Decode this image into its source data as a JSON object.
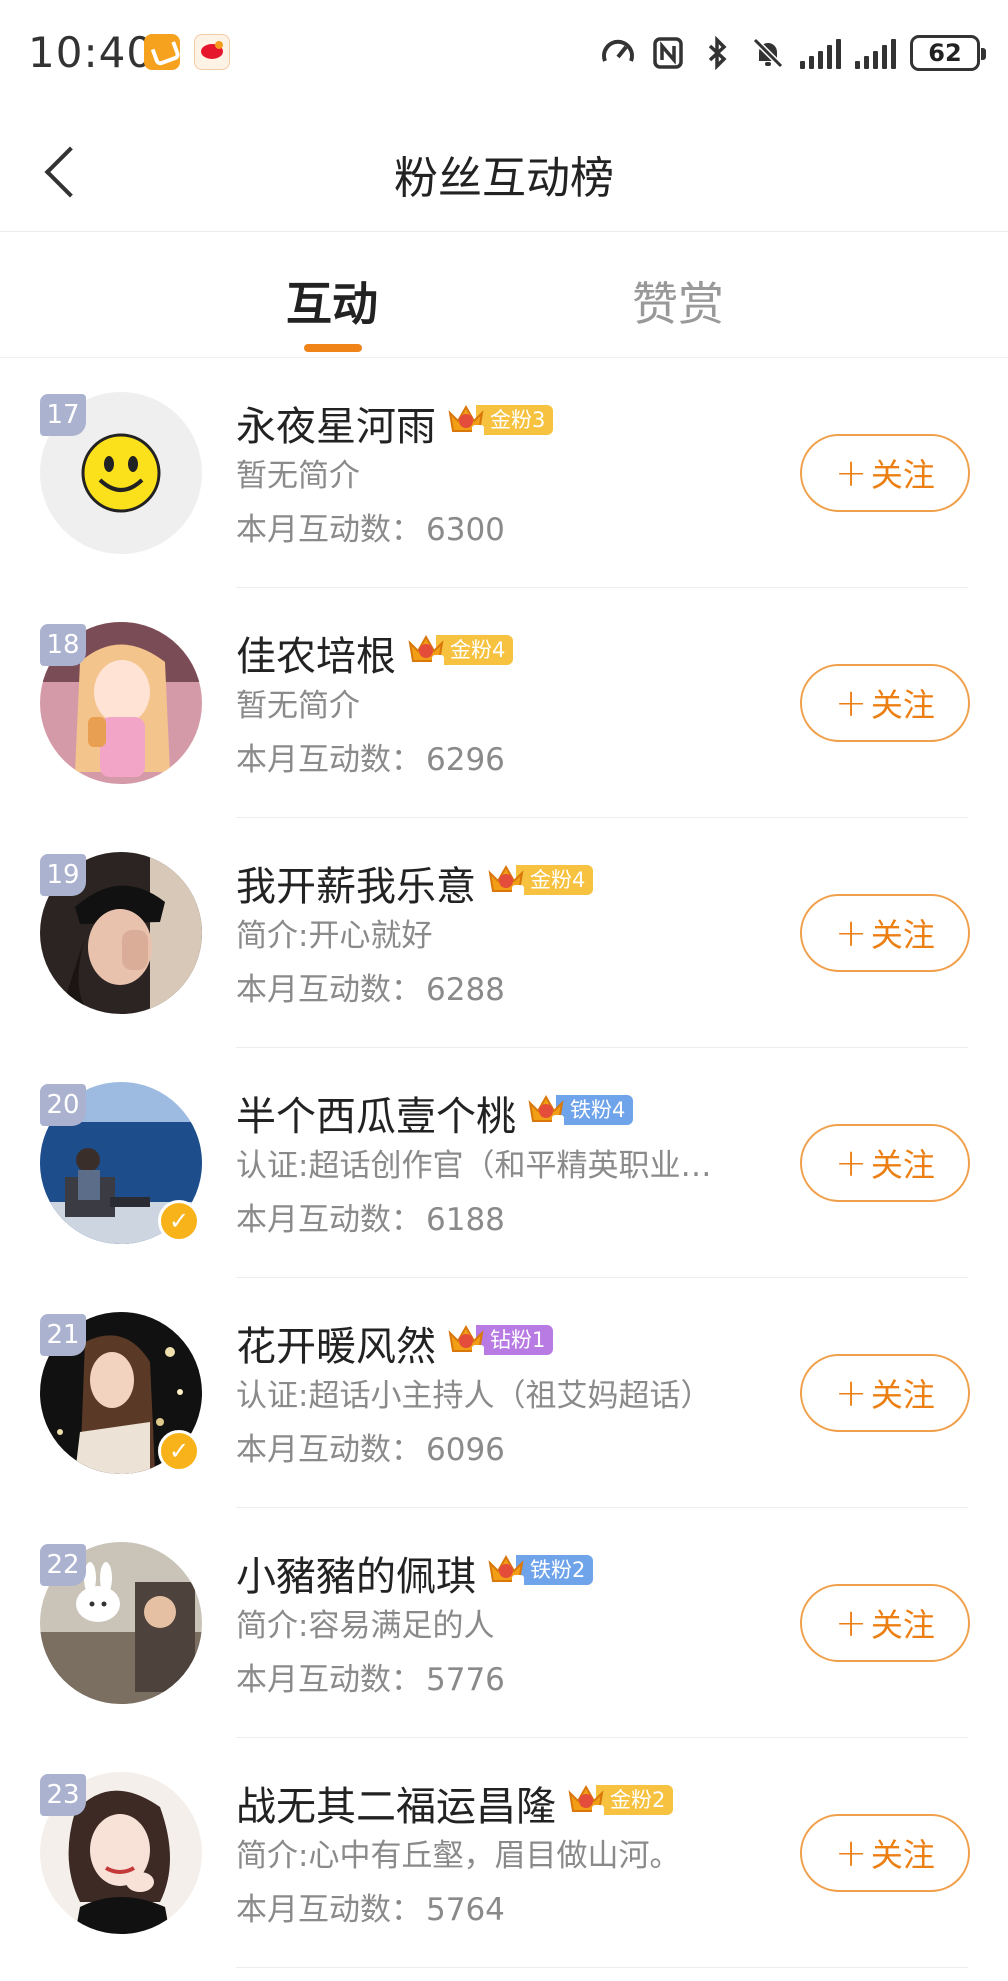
{
  "status_bar": {
    "time": "10:40",
    "battery": "62"
  },
  "header": {
    "title": "粉丝互动榜"
  },
  "tabs": [
    {
      "label": "互动",
      "active": true
    },
    {
      "label": "赞赏",
      "active": false
    }
  ],
  "colors": {
    "accent": "#f08418",
    "gold_badge": "#f7c23f",
    "iron_badge": "#6fa3ea",
    "diamond_badge": "#b77be3",
    "rank_badge": "#aab2cf"
  },
  "list": {
    "count_label": "本月互动数：",
    "follow_label": "关注",
    "follow_plus": "+",
    "items": [
      {
        "rank": "17",
        "name": "永夜星河雨",
        "badge": "金粉3",
        "badge_type": "gold",
        "bio": "暂无简介",
        "count": "6300",
        "verified": false,
        "avatar": "smiley-avatar"
      },
      {
        "rank": "18",
        "name": "佳农培根",
        "badge": "金粉4",
        "badge_type": "gold",
        "bio": "暂无简介",
        "count": "6296",
        "verified": false,
        "avatar": "anime-girl-avatar"
      },
      {
        "rank": "19",
        "name": "我开薪我乐意",
        "badge": "金粉4",
        "badge_type": "gold",
        "bio": "简介:开心就好",
        "count": "6288",
        "verified": false,
        "avatar": "girl-photo-avatar"
      },
      {
        "rank": "20",
        "name": "半个西瓜壹个桃",
        "badge": "铁粉4",
        "badge_type": "iron",
        "bio": "认证:超话创作官（和平精英职业…",
        "count": "6188",
        "verified": true,
        "avatar": "sea-photo-avatar"
      },
      {
        "rank": "21",
        "name": "花开暖风然",
        "badge": "钻粉1",
        "badge_type": "diamond",
        "bio": "认证:超话小主持人（祖艾妈超话）",
        "count": "6096",
        "verified": true,
        "avatar": "bokeh-girl-avatar"
      },
      {
        "rank": "22",
        "name": "小豬豬的佩琪",
        "badge": "铁粉2",
        "badge_type": "iron",
        "bio": "简介:容易满足的人",
        "count": "5776",
        "verified": false,
        "avatar": "rabbit-sticker-avatar"
      },
      {
        "rank": "23",
        "name": "战无其二福运昌隆",
        "badge": "金粉2",
        "badge_type": "gold",
        "bio": "简介:心中有丘壑，眉目做山河。",
        "count": "5764",
        "verified": false,
        "avatar": "illustrated-woman-avatar"
      }
    ]
  }
}
